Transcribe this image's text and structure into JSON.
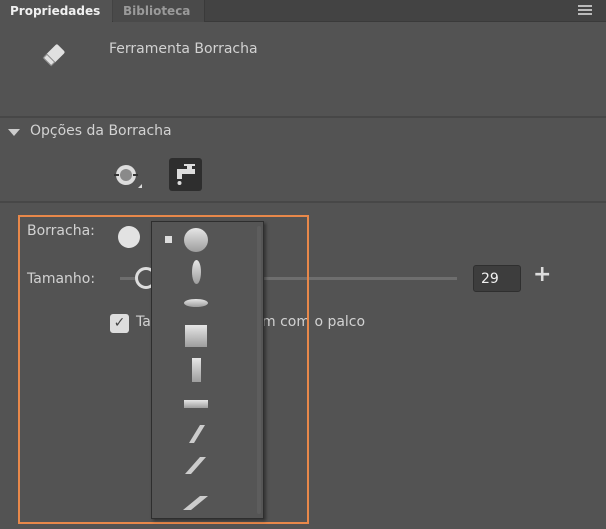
{
  "tabs": [
    {
      "label": "Propriedades",
      "active": true
    },
    {
      "label": "Biblioteca",
      "active": false
    }
  ],
  "tool": {
    "icon": "eraser-icon",
    "name": "Ferramenta Borracha"
  },
  "section": {
    "title": "Opções da Borracha",
    "modes": [
      {
        "icon": "eraser-mode-icon",
        "selected": false
      },
      {
        "icon": "faucet-icon",
        "selected": true
      }
    ]
  },
  "eraser": {
    "label": "Borracha:",
    "shape": "circle"
  },
  "size": {
    "label": "Tamanho:",
    "value": "29",
    "plus": "+"
  },
  "scale_checkbox": {
    "checked": true,
    "label_start": "Ta",
    "label_end": "m com o palco"
  },
  "shape_menu": [
    "small-square",
    "circle",
    "vertical-ellipse",
    "horizontal-ellipse",
    "square",
    "vertical-rect",
    "horizontal-rect",
    "slash-thin",
    "slash-medium",
    "slash-wide"
  ],
  "highlight_color": "#e8884a"
}
